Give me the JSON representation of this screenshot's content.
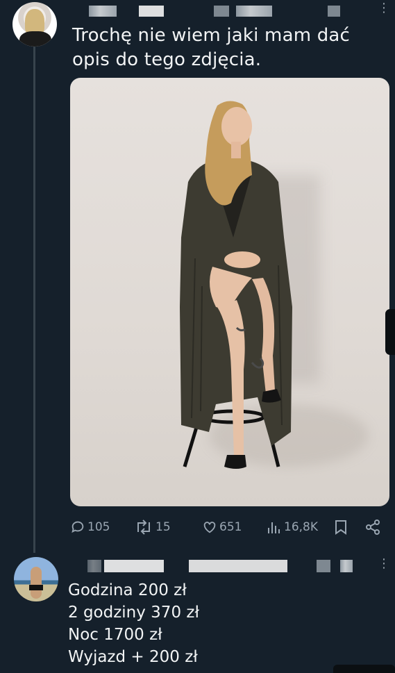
{
  "tweet": {
    "text_line_1": "Trochę nie wiem jaki mam dać",
    "text_line_2": "opis do tego zdjęcia.",
    "actions": {
      "replies": "105",
      "retweets": "15",
      "likes": "651",
      "views": "16,8K"
    },
    "icons": [
      "reply-icon",
      "retweet-icon",
      "like-icon",
      "views-icon",
      "bookmark-icon",
      "share-icon",
      "more-icon"
    ]
  },
  "reply": {
    "lines": [
      "Godzina 200 zł",
      "2 godziny 370 zł",
      "Noc 1700 zł",
      "Wyjazd + 200 zł"
    ]
  },
  "colors": {
    "background": "#15202b",
    "text": "#e7e9ea",
    "secondary": "#9aa6b2",
    "thread_line": "#38444d"
  }
}
